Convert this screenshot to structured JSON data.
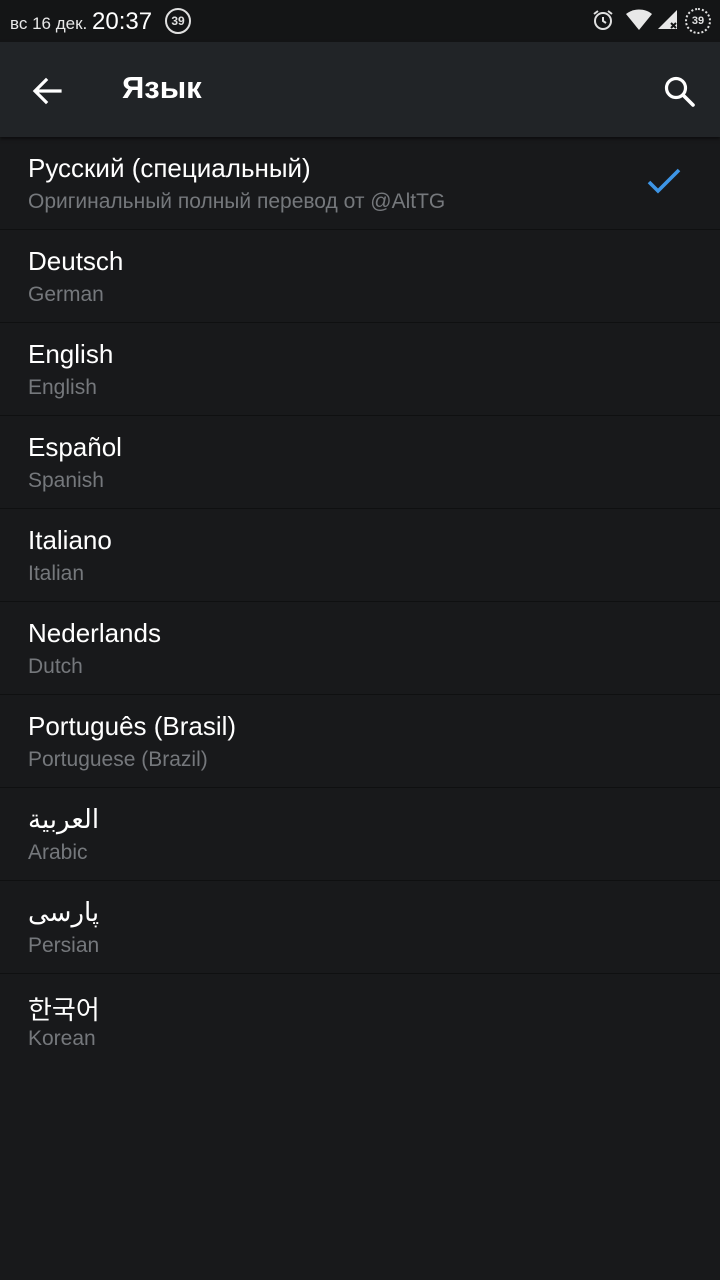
{
  "status_bar": {
    "date": "вс 16 дек.",
    "time": "20:37",
    "notification_badge": "39",
    "battery_level": "39",
    "icons": [
      "alarm-icon",
      "wifi-icon",
      "signal-icon",
      "battery-icon"
    ]
  },
  "app_bar": {
    "title": "Язык",
    "back_icon": "arrow-left-icon",
    "search_icon": "search-icon"
  },
  "colors": {
    "background": "#18191b",
    "app_bar": "#212427",
    "subtitle": "#75787c",
    "accent_check": "#3d95e6"
  },
  "languages": [
    {
      "name": "Русский (специальный)",
      "subtitle": "Оригинальный полный перевод от @AltTG",
      "selected": true
    },
    {
      "name": "Deutsch",
      "subtitle": "German",
      "selected": false
    },
    {
      "name": "English",
      "subtitle": "English",
      "selected": false
    },
    {
      "name": "Español",
      "subtitle": "Spanish",
      "selected": false
    },
    {
      "name": "Italiano",
      "subtitle": "Italian",
      "selected": false
    },
    {
      "name": "Nederlands",
      "subtitle": "Dutch",
      "selected": false
    },
    {
      "name": "Português (Brasil)",
      "subtitle": "Portuguese (Brazil)",
      "selected": false
    },
    {
      "name": "العربية",
      "subtitle": "Arabic",
      "selected": false
    },
    {
      "name": "پارسی",
      "subtitle": "Persian",
      "selected": false
    },
    {
      "name": "한국어",
      "subtitle": "Korean",
      "selected": false
    }
  ]
}
